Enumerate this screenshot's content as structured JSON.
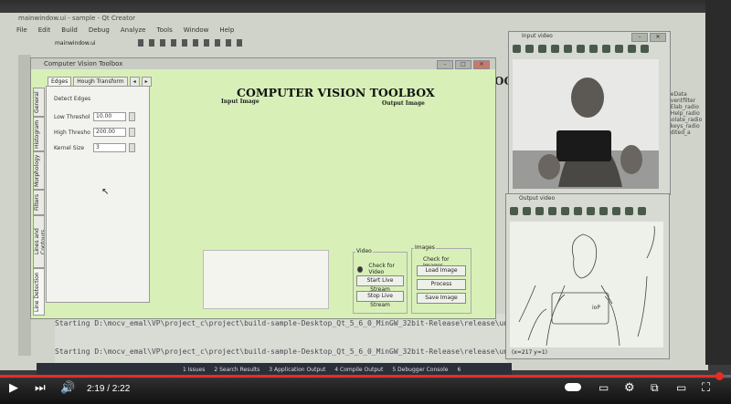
{
  "qt": {
    "title": "mainwindow.ui - sample - Qt Creator",
    "menu": [
      "File",
      "Edit",
      "Build",
      "Debug",
      "Analyze",
      "Tools",
      "Window",
      "Help"
    ],
    "file_tab": "mainwindow.ui",
    "code_line1": "Starting D:\\mocv_emal\\VP\\project_c\\project\\build-sample-Desktop_Qt_5_6_0_MinGW_32bit-Release\\release\\untitled.exe",
    "code_line2": "Starting D:\\mocv_emal\\VP\\project_c\\project\\build-sample-Desktop_Qt_5_6_0_MinGW_32bit-Release\\release\\untitled.ex",
    "bottom_tabs": [
      "1 Issues",
      "2 Search Results",
      "3 Application Output",
      "4 Compile Output",
      "5 Debugger Console",
      "6"
    ],
    "right_text": [
      "ueData",
      "Eventfilter",
      "eElab_radio",
      "hHelp_radio",
      "Isolate_radio",
      "ekeys_radio",
      "edited_a"
    ]
  },
  "toolbox": {
    "window_title": "Computer Vision Toolbox",
    "app_title": "COMPUTER VISION TOOLBOX",
    "input_label": "Input Image",
    "output_label": "Output Image",
    "tabs": [
      "Edges",
      "Hough Transform"
    ],
    "side_tabs": [
      "General",
      "Histogram",
      "Morphology",
      "Filters",
      "Lines and Contours",
      "Line Detection"
    ],
    "panel_heading": "Detect Edges",
    "low_threshold_label": "Low Threshol",
    "low_threshold_value": "10.00",
    "high_threshold_label": "High Thresho",
    "high_threshold_value": "200.00",
    "kernel_label": "Kernel Size",
    "kernel_value": "3",
    "video_group": "Video",
    "check_video": "Check for Video",
    "start_stream": "Start Live Stream",
    "stop_stream": "Stop Live Stream",
    "images_group": "Images",
    "check_images": "Check for Images",
    "load_image": "Load Image",
    "process": "Process",
    "save_image": "Save Image",
    "partial_text": "OO"
  },
  "input_video": {
    "title": "Input video"
  },
  "output_video": {
    "title": "Output video",
    "status": "(x=217 y=1)"
  },
  "player": {
    "time": "2:19 / 2:22",
    "progress": 0.985
  }
}
